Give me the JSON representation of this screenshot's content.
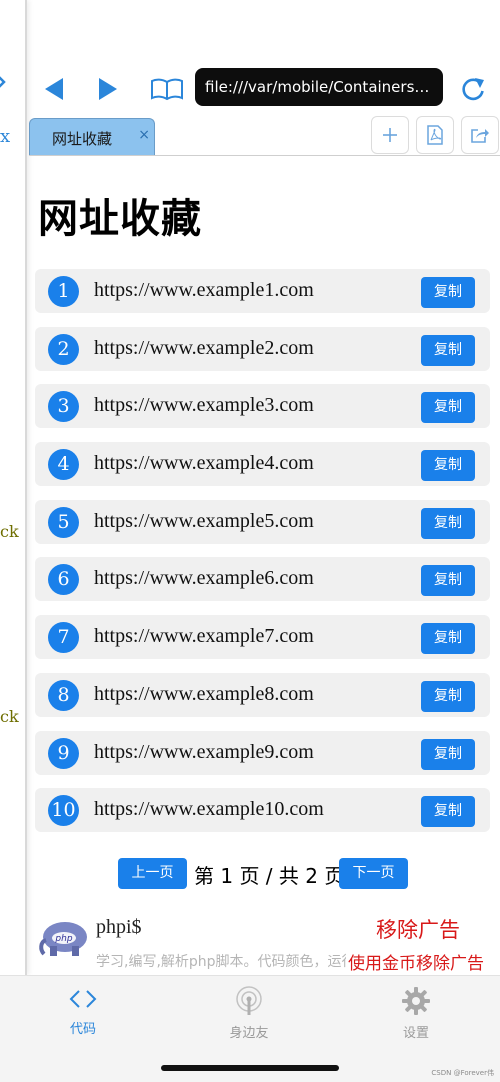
{
  "left_panel": {
    "tab_close": "x",
    "fragments": [
      "ck",
      "ck"
    ]
  },
  "toolbar": {
    "url": "file:///var/mobile/Containers/Data/Application/index.html",
    "icons": {
      "back": "back-arrow-icon",
      "forward": "forward-arrow-icon",
      "bookmarks": "book-icon",
      "reload": "reload-icon"
    }
  },
  "tabs": [
    {
      "label": "网址收藏",
      "close": "×"
    }
  ],
  "tab_actions": [
    "plus-icon",
    "pdf-icon",
    "share-icon"
  ],
  "page": {
    "title": "网址收藏"
  },
  "urls": [
    {
      "num": "1",
      "url": "https://www.example1.com",
      "copy": "复制"
    },
    {
      "num": "2",
      "url": "https://www.example2.com",
      "copy": "复制"
    },
    {
      "num": "3",
      "url": "https://www.example3.com",
      "copy": "复制"
    },
    {
      "num": "4",
      "url": "https://www.example4.com",
      "copy": "复制"
    },
    {
      "num": "5",
      "url": "https://www.example5.com",
      "copy": "复制"
    },
    {
      "num": "6",
      "url": "https://www.example6.com",
      "copy": "复制"
    },
    {
      "num": "7",
      "url": "https://www.example7.com",
      "copy": "复制"
    },
    {
      "num": "8",
      "url": "https://www.example8.com",
      "copy": "复制"
    },
    {
      "num": "9",
      "url": "https://www.example9.com",
      "copy": "复制"
    },
    {
      "num": "10",
      "url": "https://www.example10.com",
      "copy": "复制"
    }
  ],
  "pagination": {
    "prev": "上一页",
    "info": "第 1 页 / 共 2 页",
    "next": "下一页"
  },
  "ad": {
    "title": "phpi$",
    "description": "学习,编写,解析php脚本。代码颜色，运行",
    "remove": "移除广告",
    "remove_coins": "使用金币移除广告"
  },
  "bottom_nav": [
    {
      "label": "代码",
      "icon": "code-icon",
      "active": true
    },
    {
      "label": "身边友",
      "icon": "antenna-icon",
      "active": false
    },
    {
      "label": "设置",
      "icon": "gear-icon",
      "active": false
    }
  ],
  "watermark": "CSDN @Forever伟",
  "colors": {
    "accent": "#1a80ea",
    "tab_active": "#8cc2ee",
    "ad_red": "#d81919"
  }
}
